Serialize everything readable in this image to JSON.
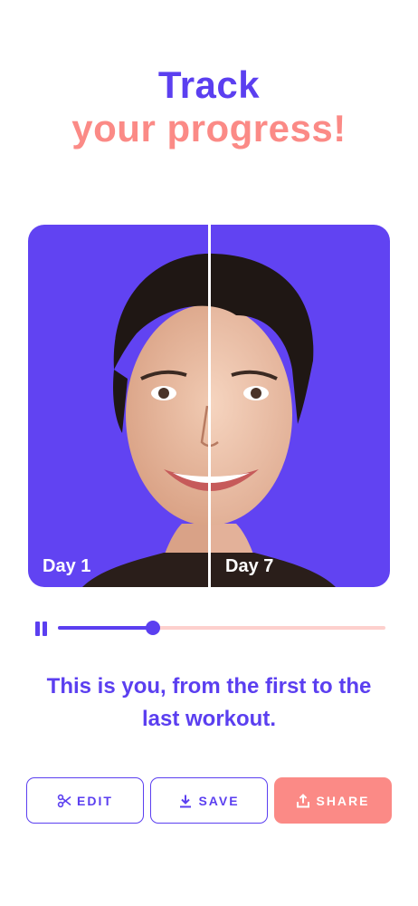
{
  "headline": {
    "line1": "Track",
    "line2": "your progress!"
  },
  "comparison": {
    "left_label": "Day 1",
    "right_label": "Day 7"
  },
  "player": {
    "state": "playing",
    "progress_fraction": 0.29
  },
  "caption": "This is you, from the first to the last workout.",
  "actions": {
    "edit": {
      "label": "EDIT",
      "icon": "scissors-icon"
    },
    "save": {
      "label": "SAVE",
      "icon": "download-icon"
    },
    "share": {
      "label": "SHARE",
      "icon": "share-icon"
    }
  },
  "colors": {
    "primary": "#5b3ff0",
    "accent": "#fb8a86",
    "photo_background": "#6143f2",
    "track_background": "#fdd0cd"
  }
}
